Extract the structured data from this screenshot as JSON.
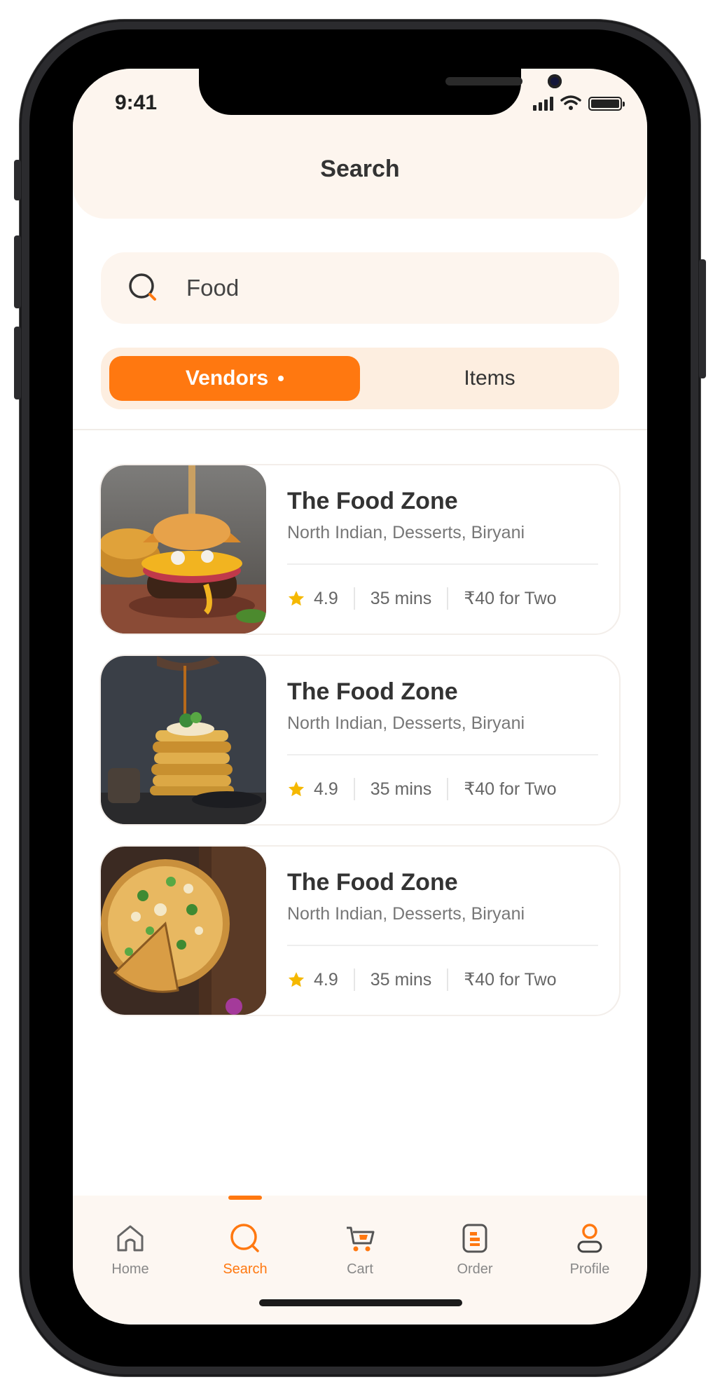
{
  "status_bar": {
    "time": "9:41"
  },
  "header": {
    "title": "Search"
  },
  "search": {
    "value": "Food"
  },
  "segment": {
    "active_label": "Vendors",
    "inactive_label": "Items"
  },
  "results": [
    {
      "name": "The Food Zone",
      "cuisine": "North Indian, Desserts, Biryani",
      "rating": "4.9",
      "time": "35 mins",
      "price": "₹40 for Two"
    },
    {
      "name": "The Food Zone",
      "cuisine": "North Indian, Desserts, Biryani",
      "rating": "4.9",
      "time": "35 mins",
      "price": "₹40 for Two"
    },
    {
      "name": "The Food Zone",
      "cuisine": "North Indian, Desserts, Biryani",
      "rating": "4.9",
      "time": "35 mins",
      "price": "₹40 for Two"
    }
  ],
  "tabbar": {
    "items": [
      {
        "label": "Home",
        "icon": "home-icon"
      },
      {
        "label": "Search",
        "icon": "search-icon",
        "active": true
      },
      {
        "label": "Cart",
        "icon": "cart-icon"
      },
      {
        "label": "Order",
        "icon": "order-icon"
      },
      {
        "label": "Profile",
        "icon": "profile-icon"
      }
    ]
  },
  "colors": {
    "accent": "#ff7810",
    "surface": "#fdf5ee",
    "star": "#f5b800"
  }
}
